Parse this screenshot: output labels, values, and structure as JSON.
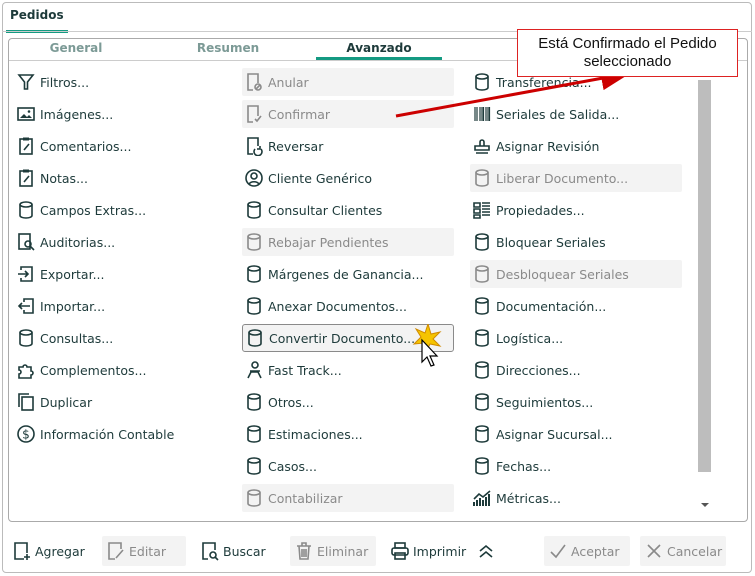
{
  "window": {
    "tab": "Pedidos"
  },
  "tabs": [
    {
      "label": "General"
    },
    {
      "label": "Resumen"
    },
    {
      "label": "Avanzado",
      "active": true
    }
  ],
  "callout": {
    "line1": "Está Confirmado el Pedido",
    "line2": "seleccionado",
    "border_color": "#dd2222"
  },
  "columns": [
    [
      {
        "label": "Filtros...",
        "icon": "filter"
      },
      {
        "label": "Imágenes...",
        "icon": "image"
      },
      {
        "label": "Comentarios...",
        "icon": "clipboard-edit"
      },
      {
        "label": "Notas...",
        "icon": "clipboard-edit"
      },
      {
        "label": "Campos Extras...",
        "icon": "database"
      },
      {
        "label": "Auditorias...",
        "icon": "audit"
      },
      {
        "label": "Exportar...",
        "icon": "export"
      },
      {
        "label": "Importar...",
        "icon": "import"
      },
      {
        "label": "Consultas...",
        "icon": "database"
      },
      {
        "label": "Complementos...",
        "icon": "puzzle"
      },
      {
        "label": "Duplicar",
        "icon": "copy"
      },
      {
        "label": "Información Contable",
        "icon": "dollar"
      }
    ],
    [
      {
        "label": "Anular",
        "icon": "doc-cancel",
        "disabled": true
      },
      {
        "label": "Confirmar",
        "icon": "doc-check",
        "disabled": true
      },
      {
        "label": "Reversar",
        "icon": "doc-undo"
      },
      {
        "label": "Cliente Genérico",
        "icon": "user-circle"
      },
      {
        "label": "Consultar Clientes",
        "icon": "database"
      },
      {
        "label": "Rebajar Pendientes",
        "icon": "database",
        "disabled": true
      },
      {
        "label": "Márgenes de Ganancia...",
        "icon": "database"
      },
      {
        "label": "Anexar Documentos...",
        "icon": "database"
      },
      {
        "label": "Convertir Documento...",
        "icon": "database",
        "hover": true
      },
      {
        "label": "Fast Track...",
        "icon": "fast-track"
      },
      {
        "label": "Otros...",
        "icon": "database"
      },
      {
        "label": "Estimaciones...",
        "icon": "database"
      },
      {
        "label": "Casos...",
        "icon": "database"
      },
      {
        "label": "Contabilizar",
        "icon": "database",
        "disabled": true
      }
    ],
    [
      {
        "label": "Transferencia...",
        "icon": "database"
      },
      {
        "label": "Seriales de Salida...",
        "icon": "barcode"
      },
      {
        "label": "Asignar Revisión",
        "icon": "stamp"
      },
      {
        "label": "Liberar Documento...",
        "icon": "database",
        "disabled": true
      },
      {
        "label": "Propiedades...",
        "icon": "grid-list"
      },
      {
        "label": "Bloquear Seriales",
        "icon": "database"
      },
      {
        "label": "Desbloquear Seriales",
        "icon": "database",
        "disabled": true
      },
      {
        "label": "Documentación...",
        "icon": "database"
      },
      {
        "label": "Logística...",
        "icon": "database"
      },
      {
        "label": "Direcciones...",
        "icon": "database"
      },
      {
        "label": "Seguimientos...",
        "icon": "database"
      },
      {
        "label": "Asignar Sucursal...",
        "icon": "database"
      },
      {
        "label": "Fechas...",
        "icon": "database"
      },
      {
        "label": "Métricas...",
        "icon": "chart-up"
      }
    ]
  ],
  "footer": [
    {
      "label": "Agregar",
      "icon": "doc-add"
    },
    {
      "label": "Editar",
      "icon": "doc-edit",
      "disabled": true
    },
    {
      "label": "Buscar",
      "icon": "doc-search"
    },
    {
      "label": "Eliminar",
      "icon": "trash",
      "disabled": true
    },
    {
      "label": "Imprimir",
      "icon": "printer"
    },
    {
      "label": "Aceptar",
      "icon": "check",
      "disabled": true
    },
    {
      "label": "Cancelar",
      "icon": "close",
      "disabled": true
    }
  ],
  "colors": {
    "accent": "#149a82",
    "text": "#1d3a3a",
    "disabled_bg": "#f3f3f3"
  }
}
